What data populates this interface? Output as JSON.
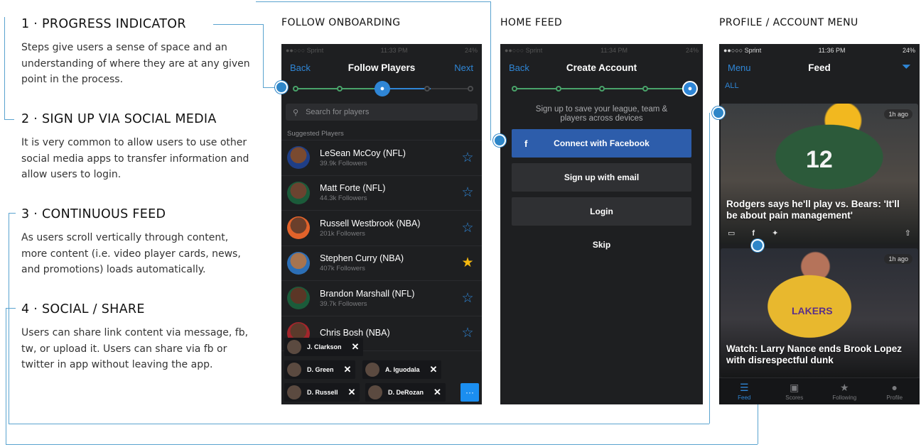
{
  "annotations": [
    {
      "title": "1 · PROGRESS INDICATOR",
      "body": "Steps give users a sense of space and an understanding of where they are at any given point in the process."
    },
    {
      "title": "2 · SIGN UP VIA SOCIAL MEDIA",
      "body": "It is very common to allow users to use other social media apps to transfer information and allow users to login."
    },
    {
      "title": "3 · CONTINUOUS FEED",
      "body": "As users scroll vertically through content, more content (i.e. video player cards, news, and promotions) loads automatically."
    },
    {
      "title": "4 · SOCIAL / SHARE",
      "body": "Users can share link content via message, fb, tw, or upload it. Users can share via fb or twitter in app without leaving the app."
    }
  ],
  "sections": {
    "follow": "FOLLOW ONBOARDING",
    "home": "HOME FEED",
    "profile": "PROFILE / ACCOUNT MENU"
  },
  "follow_screen": {
    "status": {
      "carrier": "●●○○○ Sprint",
      "time": "11:33 PM",
      "battery": "24%"
    },
    "nav": {
      "back": "Back",
      "title": "Follow Players",
      "next": "Next"
    },
    "search_placeholder": "Search for players",
    "suggested_label": "Suggested Players",
    "players": [
      {
        "name": "LeSean McCoy (NFL)",
        "followers": "39.9k Followers",
        "starred": false
      },
      {
        "name": "Matt Forte (NFL)",
        "followers": "44.3k Followers",
        "starred": false
      },
      {
        "name": "Russell Westbrook (NBA)",
        "followers": "201k Followers",
        "starred": false
      },
      {
        "name": "Stephen Curry (NBA)",
        "followers": "407k Followers",
        "starred": true
      },
      {
        "name": "Brandon Marshall (NFL)",
        "followers": "39.7k Followers",
        "starred": false
      },
      {
        "name": "Chris Bosh (NBA)",
        "followers": "",
        "starred": false
      }
    ],
    "chips": [
      "J. Clarkson",
      "D. Green",
      "A. Iguodala",
      "D. Russell",
      "D. DeRozan"
    ],
    "star_glyph_off": "☆",
    "star_glyph_on": "★",
    "close_glyph": "✕",
    "more_glyph": "···"
  },
  "home_screen": {
    "status": {
      "carrier": "●●○○○ Sprint",
      "time": "11:34 PM",
      "battery": "24%"
    },
    "nav": {
      "back": "Back",
      "title": "Create Account"
    },
    "note": "Sign up to save your league, team & players across devices",
    "buttons": {
      "facebook": "Connect with Facebook",
      "email": "Sign up with email",
      "login": "Login",
      "skip": "Skip"
    },
    "fb_glyph": "f"
  },
  "profile_screen": {
    "status": {
      "carrier": "●●○○○ Sprint",
      "time": "11:36 PM",
      "battery": "24%"
    },
    "nav": {
      "menu": "Menu",
      "title": "Feed"
    },
    "all_label": "ALL",
    "cards": [
      {
        "headline": "Rodgers says he'll play vs. Bears: 'It'll be about pain management'",
        "ago": "1h ago",
        "jersey": "12"
      },
      {
        "headline": "Watch: Larry Nance ends Brook Lopez with disrespectful dunk",
        "ago": "1h ago",
        "jersey": "LAKERS"
      }
    ],
    "tabs": [
      "Feed",
      "Scores",
      "Following",
      "Profile"
    ],
    "active_tab": "Feed"
  },
  "colors": {
    "accent": "#2f86d6",
    "connector": "#5aa3cf",
    "progress_done": "#49a36a",
    "facebook": "#2d5dab",
    "star_on": "#f5b80f"
  }
}
